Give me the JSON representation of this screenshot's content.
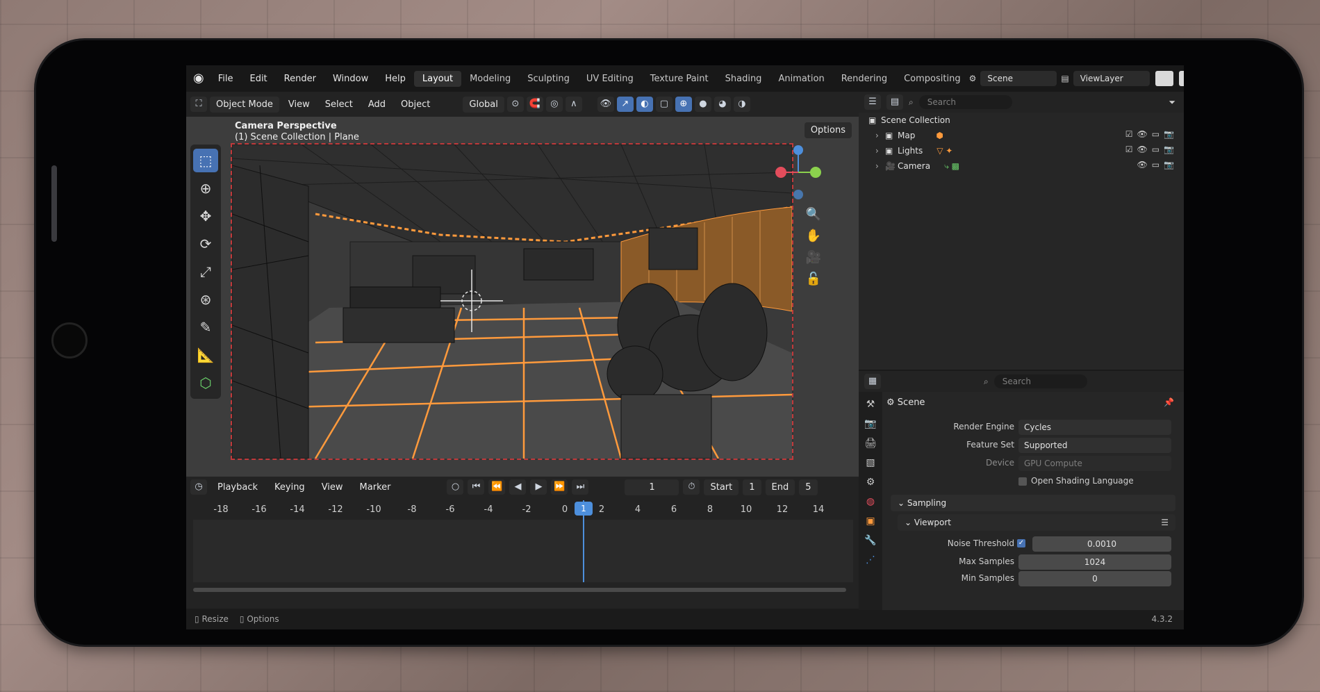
{
  "menu": {
    "items": [
      "File",
      "Edit",
      "Render",
      "Window",
      "Help"
    ]
  },
  "workspaces": {
    "tabs": [
      "Layout",
      "Modeling",
      "Sculpting",
      "UV Editing",
      "Texture Paint",
      "Shading",
      "Animation",
      "Rendering",
      "Compositing"
    ],
    "active": "Layout"
  },
  "scene_selector": {
    "scene": "Scene",
    "view_layer": "ViewLayer"
  },
  "viewport_header": {
    "mode": "Object Mode",
    "menus": [
      "View",
      "Select",
      "Add",
      "Object"
    ],
    "transform_orientation": "Global",
    "options_label": "Options"
  },
  "viewport": {
    "title": "Camera Perspective",
    "subtitle": "(1) Scene Collection | Plane"
  },
  "timeline": {
    "menus": [
      "Playback",
      "Keying",
      "View",
      "Marker"
    ],
    "current_frame": "1",
    "start_label": "Start",
    "start_value": "1",
    "end_label": "End",
    "end_value": "5",
    "ruler": [
      "-18",
      "-16",
      "-14",
      "-12",
      "-10",
      "-8",
      "-6",
      "-4",
      "-2",
      "0",
      "1",
      "2",
      "4",
      "6",
      "8",
      "10",
      "12",
      "14"
    ]
  },
  "status_bar": {
    "left": "Resize",
    "right": "Options",
    "version": "4.3.2"
  },
  "outliner": {
    "search_placeholder": "Search",
    "root": "Scene Collection",
    "items": [
      {
        "label": "Map"
      },
      {
        "label": "Lights"
      },
      {
        "label": "Camera"
      }
    ]
  },
  "properties": {
    "search_placeholder": "Search",
    "context": "Scene",
    "render_engine_label": "Render Engine",
    "render_engine": "Cycles",
    "feature_set_label": "Feature Set",
    "feature_set": "Supported",
    "device_label": "Device",
    "device": "GPU Compute",
    "osl_label": "Open Shading Language",
    "sampling_label": "Sampling",
    "viewport_label": "Viewport",
    "noise_threshold_label": "Noise Threshold",
    "noise_threshold": "0.0010",
    "max_samples_label": "Max Samples",
    "max_samples": "1024",
    "min_samples_label": "Min Samples",
    "min_samples": "0"
  },
  "colors": {
    "accent_blue": "#4772b3",
    "wire_orange": "#ff9a3c",
    "frame_red": "#c0393b"
  }
}
